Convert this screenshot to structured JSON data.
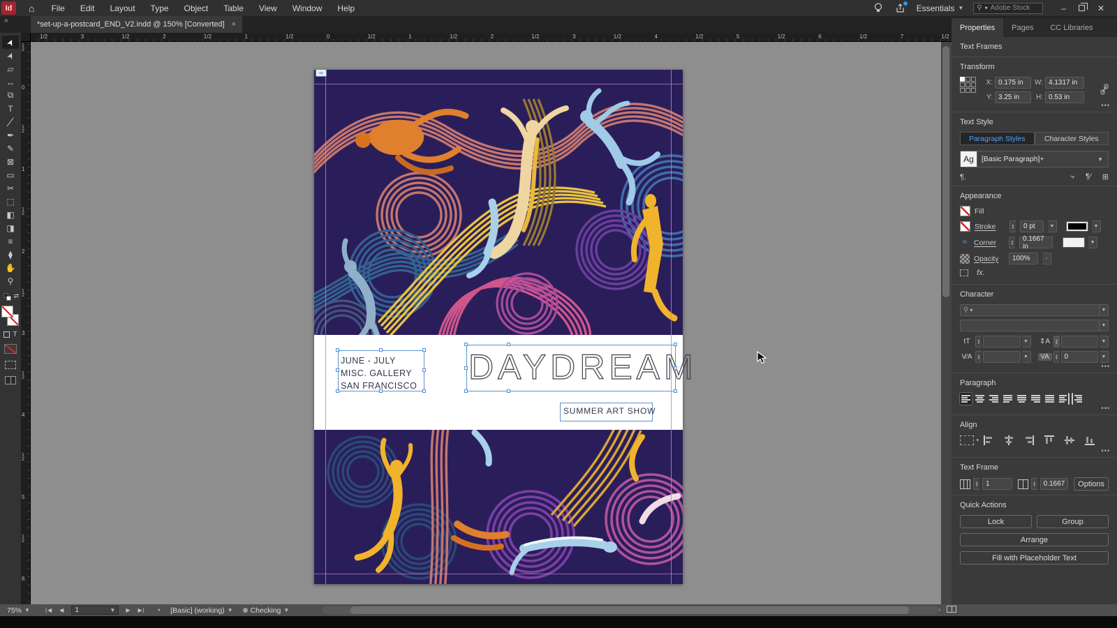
{
  "window": {
    "minimize_glyph": "–",
    "close_glyph": "✕"
  },
  "menu_bar": {
    "app_icon_label": "Id",
    "menus": [
      "File",
      "Edit",
      "Layout",
      "Type",
      "Object",
      "Table",
      "View",
      "Window",
      "Help"
    ],
    "workspace_switcher": "Essentials",
    "search_placeholder": "Adobe Stock"
  },
  "document_tab": {
    "title": "*set-up-a-postcard_END_V2.indd @ 150% [Converted]",
    "close_label": "×"
  },
  "toolbar": {
    "tools": [
      {
        "name": "selection-tool",
        "glyph": "➤"
      },
      {
        "name": "direct-selection-tool",
        "glyph": "➤"
      },
      {
        "name": "page-tool",
        "glyph": "▱"
      },
      {
        "name": "gap-tool",
        "glyph": "↔"
      },
      {
        "name": "content-collector-tool",
        "glyph": "⧉"
      },
      {
        "name": "type-tool",
        "glyph": "T"
      },
      {
        "name": "line-tool",
        "glyph": "╱"
      },
      {
        "name": "pen-tool",
        "glyph": "✒"
      },
      {
        "name": "pencil-tool",
        "glyph": "✎"
      },
      {
        "name": "frame-tool",
        "glyph": "⊠"
      },
      {
        "name": "rectangle-tool",
        "glyph": "▭"
      },
      {
        "name": "scissors-tool",
        "glyph": "✂"
      },
      {
        "name": "free-transform-tool",
        "glyph": "⬚"
      },
      {
        "name": "gradient-tool",
        "glyph": "◧"
      },
      {
        "name": "gradient-feather-tool",
        "glyph": "◨"
      },
      {
        "name": "note-tool",
        "glyph": "≡"
      },
      {
        "name": "eyedropper-tool",
        "glyph": "⧫"
      },
      {
        "name": "hand-tool",
        "glyph": "✋"
      },
      {
        "name": "zoom-tool",
        "glyph": "⚲"
      }
    ]
  },
  "rulers": {
    "horizontal": [
      "1/2",
      "3",
      "1/2",
      "2",
      "1/2",
      "1",
      "1/2",
      "0",
      "1/2",
      "1",
      "1/2",
      "2",
      "1/2",
      "3",
      "1/2",
      "4",
      "1/2",
      "5",
      "1/2",
      "6",
      "1/2",
      "7",
      "1/2"
    ],
    "vertical": [
      "1/2",
      "0",
      "1/2",
      "1",
      "1/2",
      "2",
      "1/2",
      "3",
      "1/2",
      "4",
      "1/2",
      "5",
      "1/2",
      "6"
    ]
  },
  "canvas": {
    "postcard": {
      "dates": [
        "JUNE - JULY",
        "MISC. GALLERY",
        "SAN FRANCISCO"
      ],
      "title": "DAYDREAM",
      "subtitle": "SUMMER ART SHOW"
    }
  },
  "properties_panel": {
    "tabs": [
      "Properties",
      "Pages",
      "CC Libraries"
    ],
    "selection_type": "Text Frames",
    "more_label": "•••",
    "transform": {
      "title": "Transform",
      "x_label": "X:",
      "x_value": "0.175 in",
      "y_label": "Y:",
      "y_value": "3.25 in",
      "w_label": "W:",
      "w_value": "4.1317 in",
      "h_label": "H:",
      "h_value": "0.53 in"
    },
    "text_style": {
      "title": "Text Style",
      "paragraph_tab": "Paragraph Styles",
      "character_tab": "Character Styles",
      "style_sample": "Ag",
      "style_name": "[Basic Paragraph]+"
    },
    "appearance": {
      "title": "Appearance",
      "fill_label": "Fill",
      "stroke_label": "Stroke",
      "stroke_weight": "0 pt",
      "corner_label": "Corner",
      "corner_radius": "0.1667 in",
      "opacity_label": "Opacity",
      "opacity_value": "100%",
      "effects_label": "fx."
    },
    "character": {
      "title": "Character",
      "tracking_value": "0"
    },
    "paragraph": {
      "title": "Paragraph"
    },
    "align": {
      "title": "Align"
    },
    "text_frame": {
      "title": "Text Frame",
      "columns_value": "1",
      "inset_value": "0.1667",
      "options_label": "Options"
    },
    "quick_actions": {
      "title": "Quick Actions",
      "lock_label": "Lock",
      "group_label": "Group",
      "arrange_label": "Arrange",
      "fill_placeholder_label": "Fill with Placeholder Text"
    }
  },
  "status_bar": {
    "zoom_level": "75%",
    "page_number": "1",
    "preset": "[Basic] (working)",
    "preflight_status": "Checking"
  },
  "colors": {
    "selection_blue": "#4a90d8",
    "margin_guide": "#c77ccb",
    "accent_blue": "#4da3ff",
    "artwork_background": "#2a1e5a",
    "panel_background": "#3a3a3a",
    "pasteboard": "#8e8e8e"
  }
}
